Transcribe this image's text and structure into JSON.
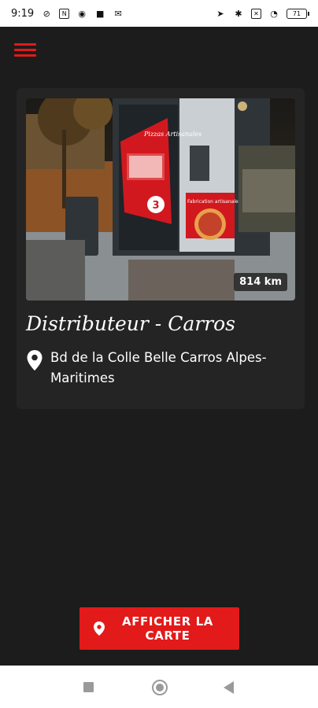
{
  "status_bar": {
    "time": "9:19",
    "left_icons": [
      "no-sim-icon",
      "n-box-icon",
      "chrome-icon",
      "trash-icon",
      "mail-icon"
    ],
    "right_icons": [
      "location-arrow-icon",
      "bluetooth-icon",
      "cross-box-icon",
      "wifi-icon"
    ],
    "battery_level": "71"
  },
  "header": {
    "menu_icon": "hamburger-menu-icon",
    "accent_color": "#e21a1a"
  },
  "location_card": {
    "distance": "814 km",
    "title": "Distributeur - Carros",
    "address": "Bd de la Colle Belle Carros Alpes-Maritimes",
    "photo_sign_text": "Pizzas Artisanales",
    "photo_side_text": "Fabrication artisanale",
    "photo_number": "3"
  },
  "cta": {
    "label": "AFFICHER LA CARTE",
    "icon": "map-pin-icon",
    "color": "#e21a1a"
  },
  "navigation_bar": {
    "recents_icon": "square-icon",
    "home_icon": "circle-icon",
    "back_icon": "triangle-back-icon"
  }
}
